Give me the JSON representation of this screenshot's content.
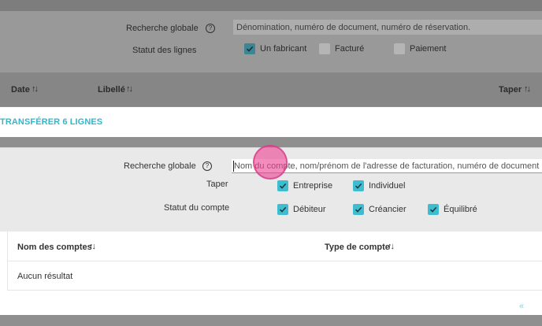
{
  "background_page": {
    "filters": {
      "global_search_label": "Recherche globale",
      "global_search_placeholder": "Dénomination, numéro de document, numéro de réservation.",
      "line_status_label": "Statut des lignes",
      "line_status_options": [
        {
          "label": "Un fabricant",
          "checked": true
        },
        {
          "label": "Facturé",
          "checked": false
        },
        {
          "label": "Paiement",
          "checked": false
        }
      ]
    },
    "table_headers": {
      "date": "Date",
      "libelle": "Libellé",
      "taper": "Taper"
    },
    "transfer_link": "TRANSFÉRER 6 LIGNES"
  },
  "modal": {
    "global_search_label": "Recherche globale",
    "global_search_placeholder": "Nom du compte, nom/prénom de l'adresse de facturation, numéro de document",
    "type_label": "Taper",
    "type_options": [
      {
        "label": "Entreprise",
        "checked": true
      },
      {
        "label": "Individuel",
        "checked": true
      }
    ],
    "account_status_label": "Statut du compte",
    "account_status_options": [
      {
        "label": "Débiteur",
        "checked": true
      },
      {
        "label": "Créancier",
        "checked": true
      },
      {
        "label": "Équilibré",
        "checked": true
      }
    ],
    "table": {
      "col_account_names": "Nom des comptes",
      "col_account_type": "Type de compte",
      "empty_message": "Aucun résultat"
    },
    "pager_prev": "«"
  },
  "colors": {
    "accent": "#3fbdd0",
    "overlay": "#8f8f8f",
    "touch_indicator": "#ec4092"
  },
  "icons": {
    "help": "help-circle-icon",
    "sort": "sort-arrows-icon",
    "check": "check-icon",
    "pager_prev": "double-chevron-left-icon"
  }
}
